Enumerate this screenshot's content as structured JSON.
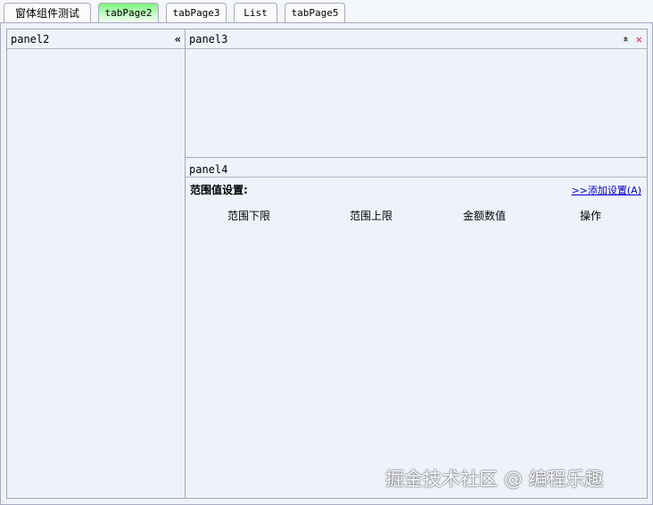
{
  "tabs": [
    {
      "label": "窗体组件测试"
    },
    {
      "label": "tabPage2"
    },
    {
      "label": "tabPage3"
    },
    {
      "label": "List"
    },
    {
      "label": "tabPage5"
    }
  ],
  "panel2": {
    "title": "panel2",
    "collapse_icon": "«"
  },
  "panel3": {
    "title": "panel3",
    "expand_icon": "»",
    "close_icon": "✕"
  },
  "panel4": {
    "title": "panel4",
    "heading": "范围值设置:",
    "add_link": ">>添加设置(A)",
    "columns": [
      "范围下限",
      "范围上限",
      "金额数值",
      "操作"
    ]
  },
  "watermark": "掘金技术社区 @ 编程乐趣",
  "colors": {
    "active_tab": "#7ef57e",
    "close": "#e02020",
    "link": "#0000cc"
  }
}
